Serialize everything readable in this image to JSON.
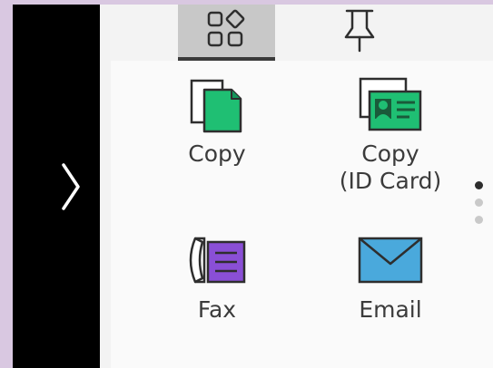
{
  "tabs": [
    {
      "id": "apps",
      "icon": "app-grid-icon",
      "selected": true
    },
    {
      "id": "pinned",
      "icon": "pushpin-icon",
      "selected": false
    }
  ],
  "apps": [
    {
      "id": "copy",
      "label": "Copy",
      "icon": "copy-document-icon",
      "color": "#1fbf73"
    },
    {
      "id": "id_copy",
      "label_line1": "Copy",
      "label_line2": "(ID Card)",
      "icon": "id-card-copy-icon",
      "color": "#1fbf73"
    },
    {
      "id": "fax",
      "label": "Fax",
      "icon": "fax-phone-icon",
      "color": "#8a4fd6"
    },
    {
      "id": "email",
      "label": "Email",
      "icon": "envelope-icon",
      "color": "#4aa9dc"
    }
  ],
  "pagination": {
    "pages": 3,
    "current": 1
  },
  "sidebar": {
    "expand_icon": "chevron-right-icon"
  },
  "colors": {
    "frame": "#000000",
    "background": "#d9c8e1",
    "panel": "#fafafa",
    "tab_selected": "#c8c8c8",
    "text": "#3b3b3b"
  }
}
